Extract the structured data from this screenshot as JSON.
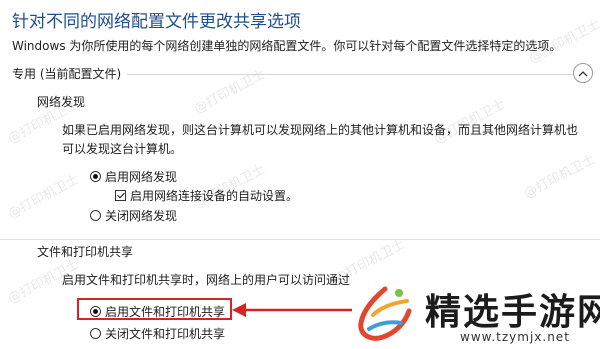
{
  "page": {
    "title": "针对不同的网络配置文件更改共享选项",
    "description": "Windows 为你所使用的每个网络创建单独的网络配置文件。你可以针对每个配置文件选择特定的选项。"
  },
  "section": {
    "label": "专用 (当前配置文件)"
  },
  "network_discovery": {
    "heading": "网络发现",
    "text_line1": "如果已启用网络发现，则这台计算机可以发现网络上的其他计算机和设备，而且其他网络计算机也",
    "text_line2": "可以发现这台计算机。",
    "enable_label": "启用网络发现",
    "auto_setup_label": "启用网络连接设备的自动设置。",
    "disable_label": "关闭网络发现"
  },
  "file_printer_sharing": {
    "heading": "文件和打印机共享",
    "text": "启用文件和打印机共享时，网络上的用户可以访问通过",
    "enable_label": "启用文件和打印机共享",
    "disable_label": "关闭文件和打印机共享"
  },
  "watermark": {
    "text": "@打印机卫士"
  },
  "brand": {
    "name": "精选手游网",
    "url": "www.tzymjx.net"
  },
  "colors": {
    "title": "#1f4e8c",
    "highlight_box": "#d6232a",
    "arrow": "#d6232a"
  }
}
